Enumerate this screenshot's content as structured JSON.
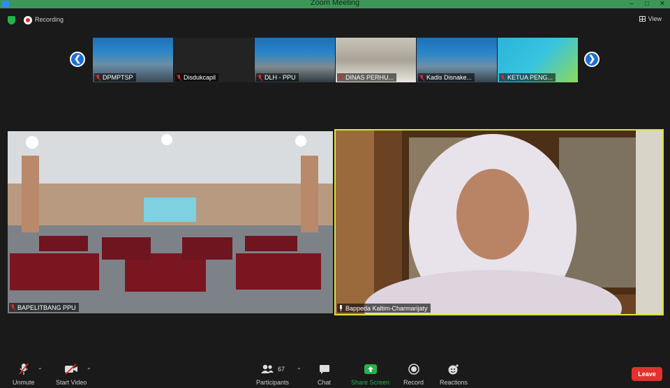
{
  "window": {
    "title": "Zoom Meeting",
    "controls": [
      "–",
      "□",
      "✕"
    ]
  },
  "topbar": {
    "recording_label": "Recording",
    "view_label": "View"
  },
  "thumbnails": [
    {
      "name": "DPMPTSP",
      "muted": true
    },
    {
      "name": "Disdukcapil",
      "muted": true
    },
    {
      "name": "DLH - PPU",
      "muted": true
    },
    {
      "name": "DINAS PERHU...",
      "muted": true
    },
    {
      "name": "Kadis Disnake...",
      "muted": true
    },
    {
      "name": "KETUA PENG...",
      "muted": true
    }
  ],
  "main_videos": [
    {
      "name": "BAPELITBANG PPU",
      "muted": true
    },
    {
      "name": "Bappeda Kaltim-Charmarijaty",
      "muted": false
    }
  ],
  "toolbar": {
    "unmute": "Unmute",
    "start_video": "Start Video",
    "participants": "Participants",
    "participants_count": "67",
    "chat": "Chat",
    "share_screen": "Share Screen",
    "record": "Record",
    "reactions": "Reactions",
    "leave": "Leave"
  },
  "colors": {
    "active_speaker_border": "#d6e63b",
    "share_green": "#22b34a",
    "leave_red": "#e0322f",
    "title_bar": "#3d9657"
  }
}
